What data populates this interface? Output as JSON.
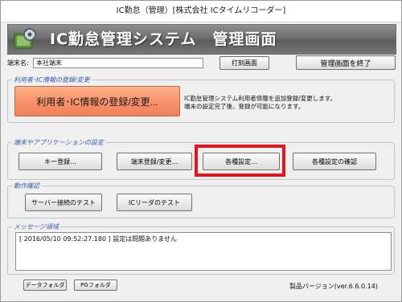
{
  "window": {
    "title": "IC勤怠（管理）[株式会社 ICタイムリコーダー]"
  },
  "banner": {
    "title": "IC勤怠管理システム　管理画面"
  },
  "terminal": {
    "label": "端末名:",
    "value": "本社端末"
  },
  "toolbar": {
    "print_label": "打刻画面",
    "exit_label": "管理画面を終了"
  },
  "user_section": {
    "legend": "利用者･IC情報の登録/変更",
    "button_label": "利用者･IC情報の登録/変更...",
    "description_line1": "IC勤怠管理システム利用者情報を追加登録/変更します。",
    "description_line2": "端末の設定完了後、登録が可能になります。"
  },
  "settings_section": {
    "legend": "端末やアプリケーションの設定",
    "key_button": "キー登録...",
    "terminal_button": "端末登録/変更...",
    "settings_button": "各種設定...",
    "confirm_button": "各種設定の確認"
  },
  "test_section": {
    "legend": "動作確認",
    "server_button": "サーバー接続のテスト",
    "reader_button": "ICリーダのテスト"
  },
  "message_section": {
    "legend": "メッセージ領域",
    "log": "[ 2016/05/10 09:52:27.180 ] 設定は問題ありません"
  },
  "footer": {
    "data_folder": "データフォルダ",
    "pg_folder": "PGフォルダ",
    "version": "製品バージョン(ver.6.6.0.14)"
  },
  "colors": {
    "accent_orange": "#f7916a",
    "highlight_red": "#e8141b",
    "legend_blue": "#3a5aa8"
  },
  "icons": {
    "app": "gear-icon"
  }
}
